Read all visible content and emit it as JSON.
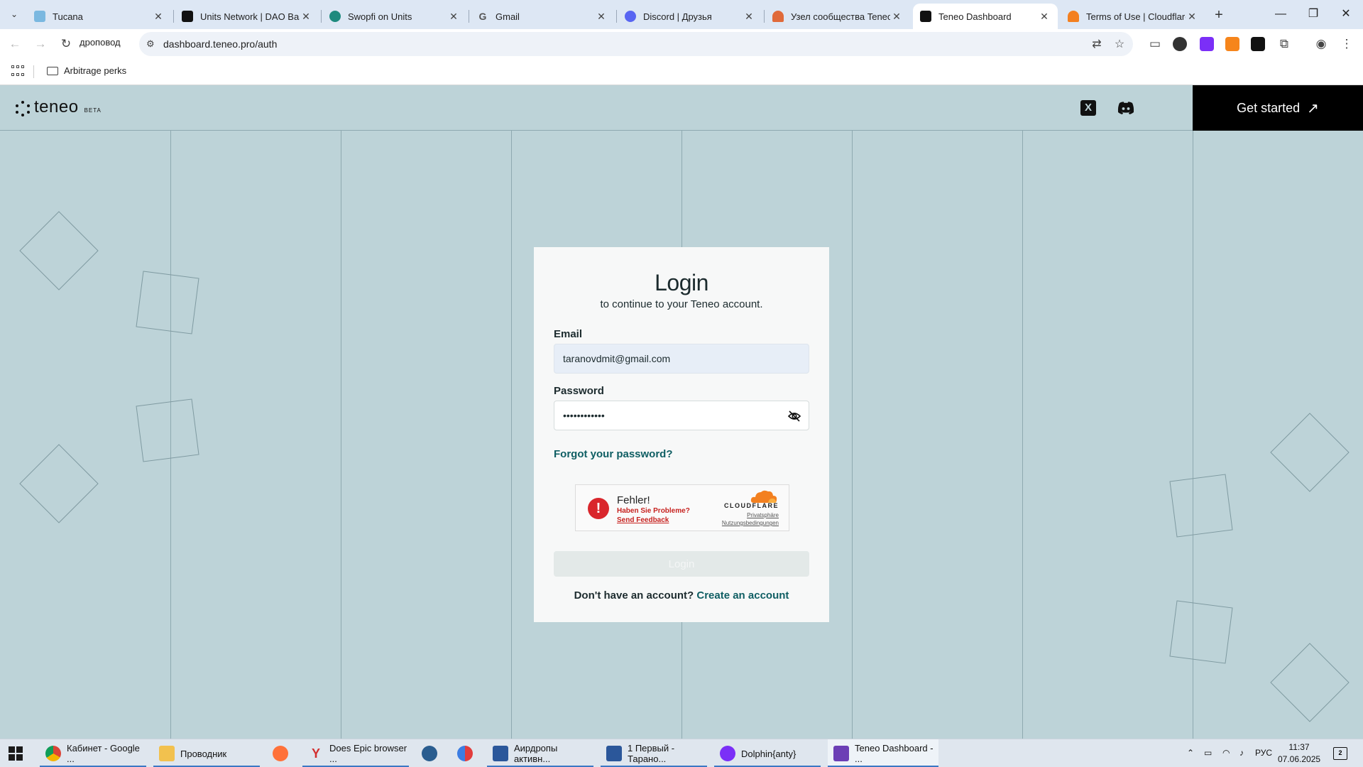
{
  "browser": {
    "tabs": [
      {
        "title": "Tucana"
      },
      {
        "title": "Units Network | DAO Base"
      },
      {
        "title": "Swopfi on Units"
      },
      {
        "title": "Gmail"
      },
      {
        "title": "Discord | Друзья"
      },
      {
        "title": "Узел сообщества Teneo"
      },
      {
        "title": "Teneo Dashboard"
      },
      {
        "title": "Terms of Use | Cloudflare"
      }
    ],
    "profile_label": "дроповод",
    "url": "dashboard.teneo.pro/auth",
    "bookmark_folder": "Arbitrage perks"
  },
  "site": {
    "logo_word": "teneo",
    "logo_badge": "BETA",
    "social_x": "X",
    "get_started": "Get started",
    "get_started_arrow": "↗"
  },
  "login": {
    "title": "Login",
    "subtitle": "to continue to your Teneo account.",
    "email_label": "Email",
    "email_value": "taranovdmit@gmail.com",
    "password_label": "Password",
    "password_value": "••••••••••••",
    "forgot": "Forgot your password?",
    "submit": "Login",
    "no_account": "Don't have an account?",
    "create_account": "Create an account"
  },
  "captcha": {
    "error_mark": "!",
    "error_title": "Fehler!",
    "problem": "Haben Sie Probleme?",
    "feedback": "Send Feedback",
    "brand": "CLOUDFLARE",
    "privacy": "Privatsphäre",
    "terms": "Nutzungsbedingungen"
  },
  "taskbar": {
    "items": [
      {
        "label": "Кабинет - Google ..."
      },
      {
        "label": "Проводник"
      },
      {
        "label": "Does Epic browser ..."
      },
      {
        "label": "Аирдропы активн..."
      },
      {
        "label": "1 Первый - Тарано..."
      },
      {
        "label": "Dolphin{anty}"
      },
      {
        "label": "Teneo Dashboard - ..."
      }
    ],
    "lang": "РУС",
    "time": "11:37",
    "date": "07.06.2025",
    "notifications": "2"
  },
  "colors": {
    "page_bg": "#bdd3d8",
    "accent": "#0f5e63",
    "captcha_error": "#d9262c",
    "cloudflare_orange": "#f38020"
  }
}
